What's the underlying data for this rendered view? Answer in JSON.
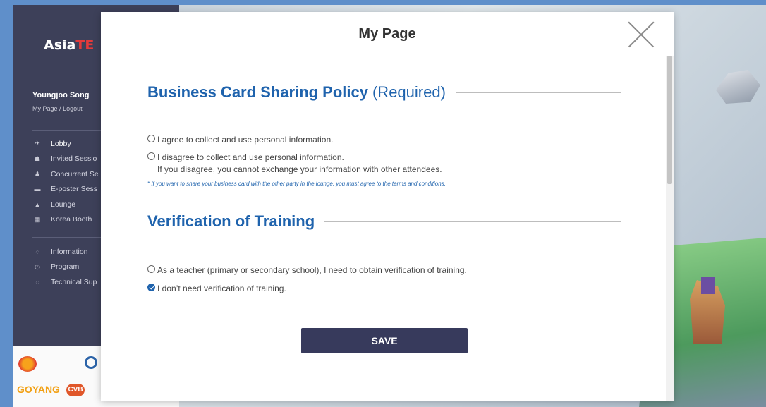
{
  "colors": {
    "accent": "#1f63ad",
    "button": "#373a5c",
    "sidebar": "#3d4059"
  },
  "sidebar": {
    "logo_a": "Asia",
    "logo_b": "TE",
    "user_name": "Youngjoo Song",
    "my_page": "My Page",
    "sep": "/",
    "logout": "Logout",
    "nav": [
      {
        "label": "Lobby",
        "icon": "plane-icon"
      },
      {
        "label": "Invited Sessio",
        "icon": "person-icon"
      },
      {
        "label": "Concurrent Se",
        "icon": "people-icon"
      },
      {
        "label": "E-poster Sess",
        "icon": "poster-icon"
      },
      {
        "label": "Lounge",
        "icon": "coffee-icon"
      },
      {
        "label": "Korea Booth",
        "icon": "booth-icon"
      }
    ],
    "nav2": [
      {
        "label": "Information",
        "icon": "chat-icon"
      },
      {
        "label": "Program",
        "icon": "clock-icon"
      },
      {
        "label": "Technical Sup",
        "icon": "chat-icon"
      }
    ],
    "partner_goyang": "GOYANG",
    "partner_cvb": "CVB"
  },
  "modal": {
    "title": "My Page",
    "policy": {
      "title": "Business Card Sharing Policy",
      "required": "(Required)",
      "agree": "I agree to collect and use personal information.",
      "disagree": "I disagree to collect and use personal information.",
      "disagree_sub": "If you disagree, you cannot exchange your information with other attendees.",
      "note": "* If you want to share your business card with the other party in the lounge, you must agree to the terms and conditions."
    },
    "training": {
      "title": "Verification of Training",
      "teacher": "As a teacher (primary or secondary school), I need to obtain verification of training.",
      "no_need": "I don’t need verification of training.",
      "selected": "no_need"
    },
    "save_label": "SAVE"
  }
}
